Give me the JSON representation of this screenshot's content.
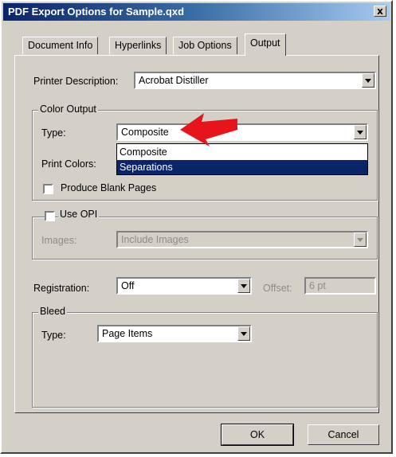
{
  "window": {
    "title": "PDF Export Options for Sample.qxd",
    "close_label": "x"
  },
  "tabs": [
    {
      "label": "Document Info"
    },
    {
      "label": "Hyperlinks"
    },
    {
      "label": "Job Options"
    },
    {
      "label": "Output",
      "active": true
    }
  ],
  "printer": {
    "label": "Printer Description:",
    "value": "Acrobat Distiller"
  },
  "color_output": {
    "group_label": "Color Output",
    "type_label": "Type:",
    "type_value": "Composite",
    "options": [
      "Composite",
      "Separations"
    ],
    "highlighted_option": "Separations",
    "print_colors_label": "Print Colors:",
    "blank_pages_label": "Produce Blank Pages"
  },
  "opi": {
    "use_label": "Use OPI",
    "images_label": "Images:",
    "images_value": "Include Images"
  },
  "registration": {
    "label": "Registration:",
    "value": "Off",
    "offset_label": "Offset:",
    "offset_value": "6 pt"
  },
  "bleed": {
    "group_label": "Bleed",
    "type_label": "Type:",
    "type_value": "Page Items"
  },
  "buttons": {
    "ok": "OK",
    "cancel": "Cancel"
  },
  "colors": {
    "title_start": "#0a246a",
    "face": "#d4d0c8",
    "highlight": "#0a246a",
    "annotation_arrow": "#e8141b"
  }
}
